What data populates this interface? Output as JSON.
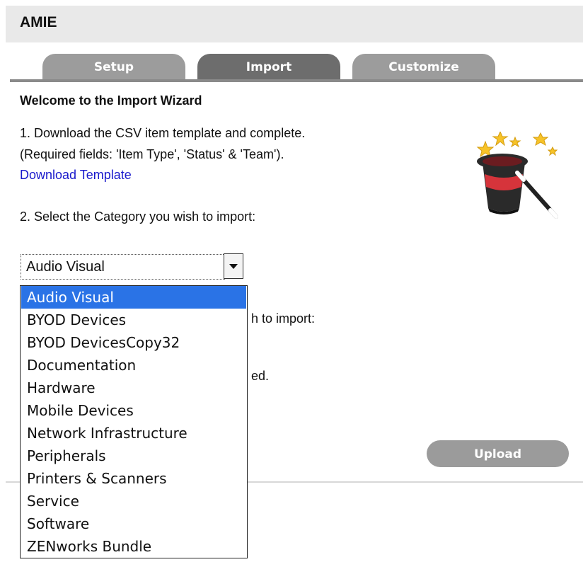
{
  "app": {
    "title": "AMIE"
  },
  "tabs": [
    {
      "label": "Setup",
      "active": false
    },
    {
      "label": "Import",
      "active": true
    },
    {
      "label": "Customize",
      "active": false
    }
  ],
  "wizard": {
    "title": "Welcome to the Import Wizard",
    "step1_line1": "1. Download the CSV item template and complete.",
    "step1_line2": "(Required fields: 'Item Type', 'Status' & 'Team').",
    "download_link": "Download Template",
    "step2_label": "2. Select the Category you wish to import:",
    "hidden_partial_1": "h to import:",
    "hidden_partial_2": "ed.",
    "icon": "magic-hat-icon"
  },
  "category_select": {
    "selected": "Audio Visual",
    "options": [
      "Audio Visual",
      "BYOD Devices",
      "BYOD DevicesCopy32",
      "Documentation",
      "Hardware",
      "Mobile Devices",
      "Network Infrastructure",
      "Peripherals",
      "Printers & Scanners",
      "Service",
      "Software",
      "ZENworks Bundle"
    ]
  },
  "actions": {
    "upload_label": "Upload"
  },
  "colors": {
    "header_bg": "#e9e9e9",
    "tab_inactive": "#9c9c9c",
    "tab_active": "#6d6d6d",
    "link": "#1a1acc",
    "selected_option": "#2a73e6",
    "upload_button": "#9b9b9b"
  }
}
